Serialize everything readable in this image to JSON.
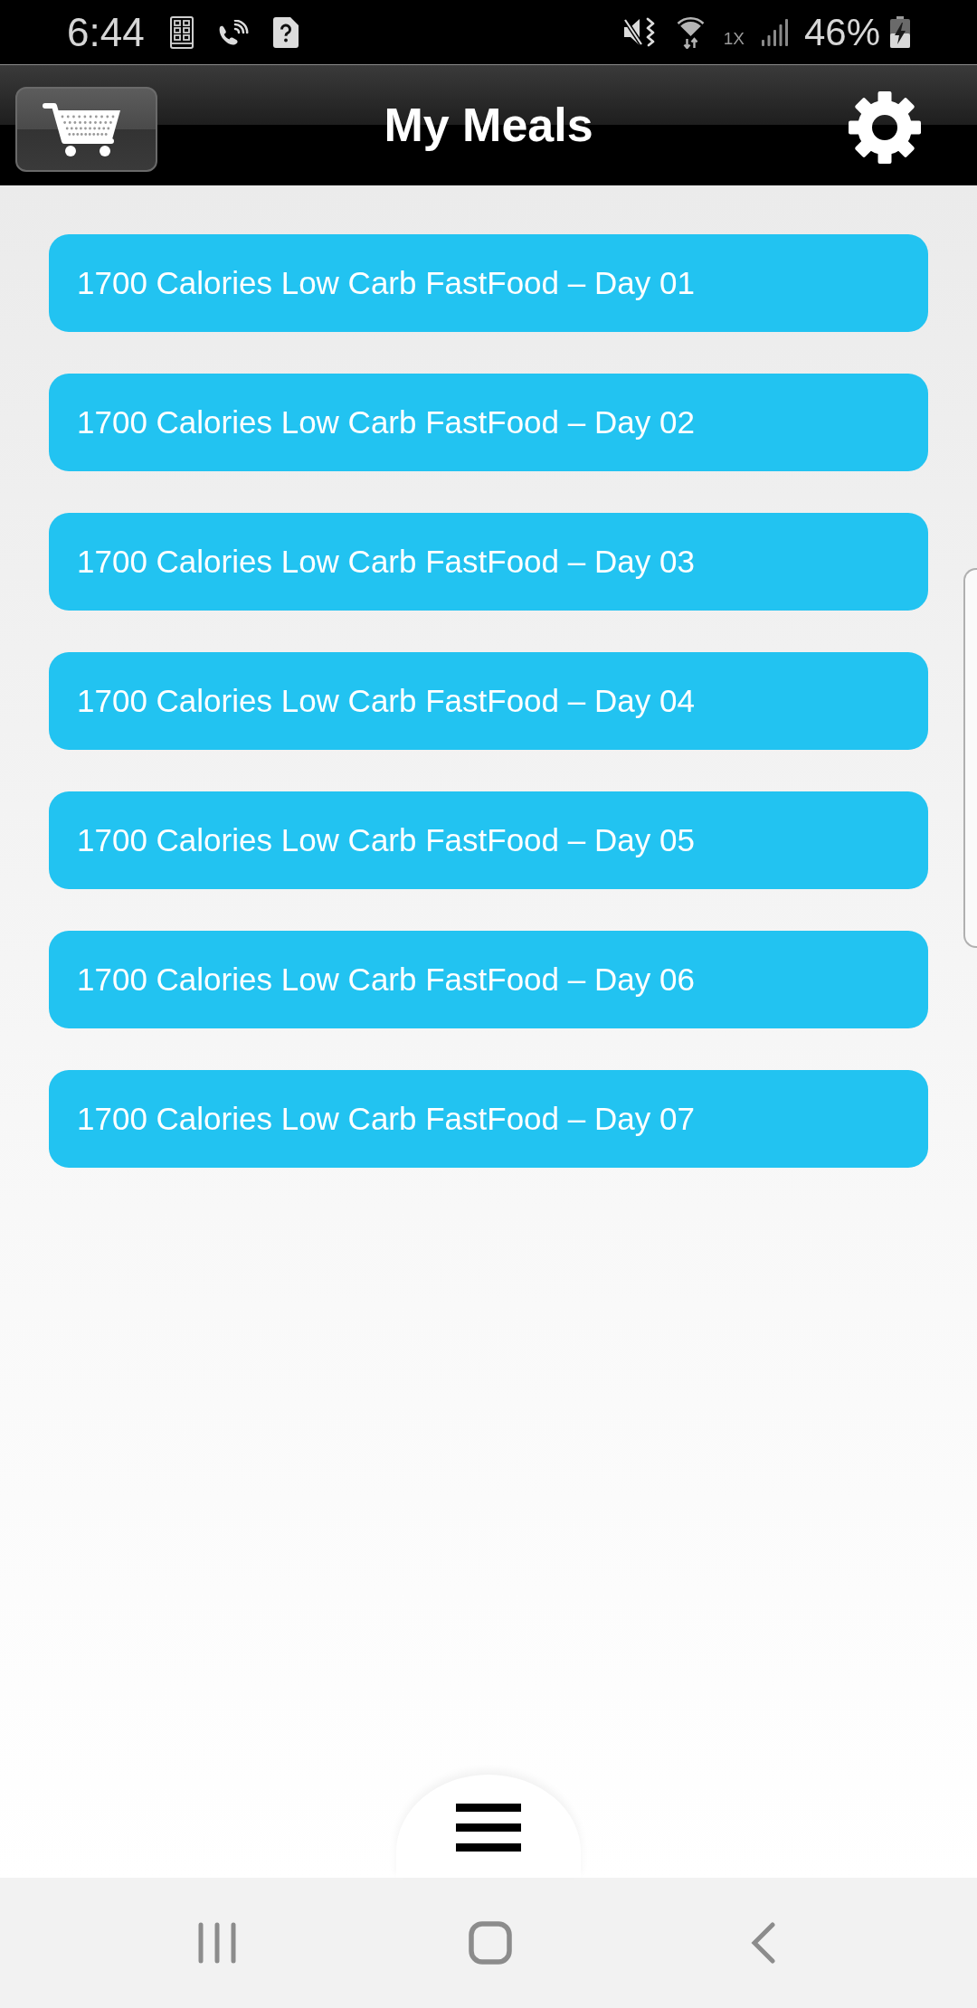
{
  "status_bar": {
    "time": "6:44",
    "network": "1X",
    "battery": "46%"
  },
  "header": {
    "title": "My Meals"
  },
  "meals": [
    "1700 Calories Low Carb FastFood – Day 01",
    "1700 Calories Low Carb FastFood – Day 02",
    "1700 Calories Low Carb FastFood – Day 03",
    "1700 Calories Low Carb FastFood – Day 04",
    "1700 Calories Low Carb FastFood – Day 05",
    "1700 Calories Low Carb FastFood – Day 06",
    "1700 Calories Low Carb FastFood – Day 07"
  ]
}
